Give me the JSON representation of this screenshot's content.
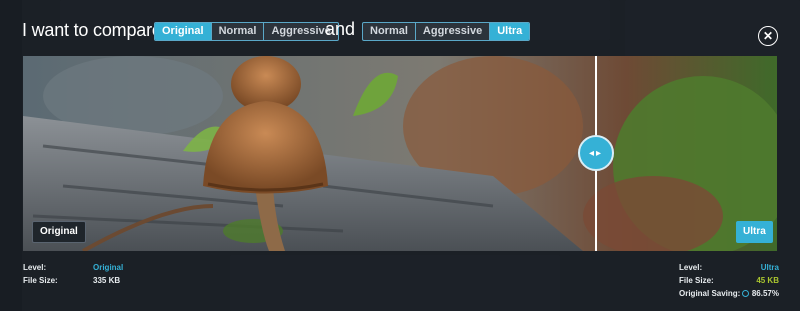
{
  "header": {
    "title": "I want to compare",
    "connector": "and",
    "left_levels": [
      {
        "label": "Original",
        "active": true
      },
      {
        "label": "Normal",
        "active": false
      },
      {
        "label": "Aggressive",
        "active": false
      }
    ],
    "right_levels": [
      {
        "label": "Normal",
        "active": false
      },
      {
        "label": "Aggressive",
        "active": false
      },
      {
        "label": "Ultra",
        "active": true
      }
    ],
    "close_icon": "close-icon"
  },
  "compare": {
    "left_tag": "Original",
    "right_tag": "Ultra",
    "handle_icon": "left-right-arrows-icon",
    "handle_glyph": "◂▸"
  },
  "stats_left": {
    "level_label": "Level:",
    "level_value": "Original",
    "size_label": "File Size:",
    "size_value": "335 KB"
  },
  "stats_right": {
    "level_label": "Level:",
    "level_value": "Ultra",
    "size_label": "File Size:",
    "size_value": "45 KB",
    "saving_label": "Original Saving:",
    "saving_value": "86.57%",
    "saving_icon": "pie-chart-icon"
  },
  "colors": {
    "accent": "#35b1d6",
    "size_green": "#a9c52f",
    "overlay": "#161b21"
  }
}
